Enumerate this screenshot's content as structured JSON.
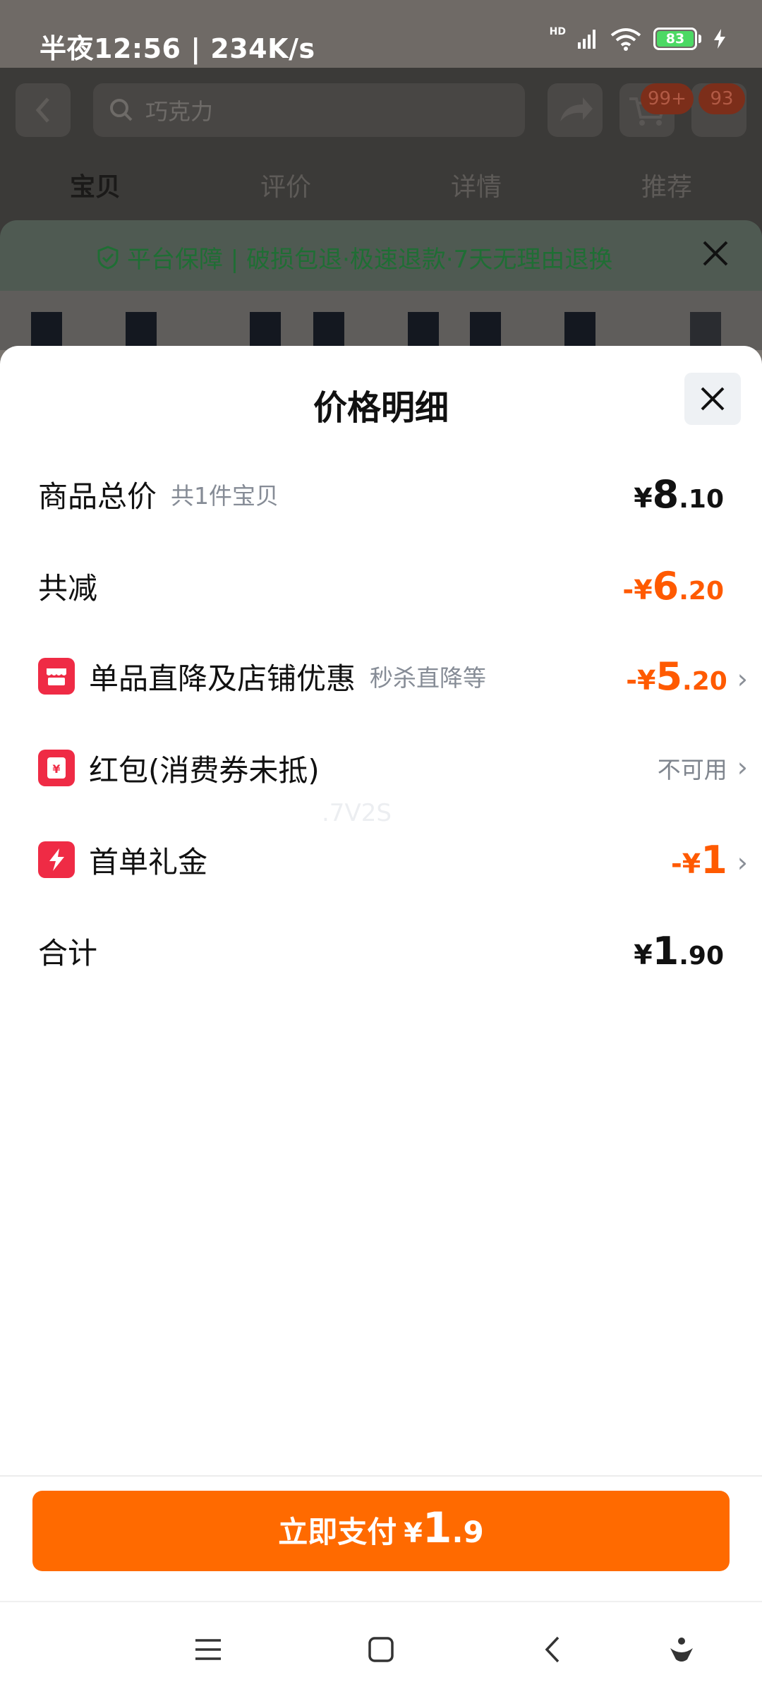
{
  "status_bar": {
    "time_speed": "半夜12:56 | 234K/s",
    "hd": "HD",
    "battery": "83"
  },
  "background": {
    "search_placeholder": "巧克力",
    "badges": [
      "99+",
      "93"
    ],
    "tabs": [
      "宝贝",
      "评价",
      "详情",
      "推荐"
    ],
    "guarantee": "平台保障 | 破损包退·极速退款·7天无理由退换"
  },
  "sheet": {
    "title": "价格明细",
    "rows": {
      "total": {
        "label": "商品总价",
        "sub": "共1件宝贝",
        "currency": "¥",
        "int": "8",
        "dec": ".10"
      },
      "reduce": {
        "label": "共减",
        "currency": "-¥",
        "int": "6",
        "dec": ".20"
      },
      "discount": {
        "label": "单品直降及店铺优惠",
        "sub": "秒杀直降等",
        "currency": "-¥",
        "int": "5",
        "dec": ".20"
      },
      "redpacket": {
        "label": "红包(消费券未抵)",
        "status": "不可用"
      },
      "firstorder": {
        "label": "首单礼金",
        "currency": "-¥",
        "int": "1"
      },
      "sum": {
        "label": "合计",
        "currency": "¥",
        "int": "1",
        "dec": ".90"
      }
    },
    "watermark": ".7V2S"
  },
  "pay_button": {
    "label": "立即支付",
    "currency": "¥",
    "int": "1",
    "dec": ".9"
  },
  "colors": {
    "accent": "#ff6a00",
    "discount": "#ff5a00",
    "icon_red": "#ef2b45"
  }
}
